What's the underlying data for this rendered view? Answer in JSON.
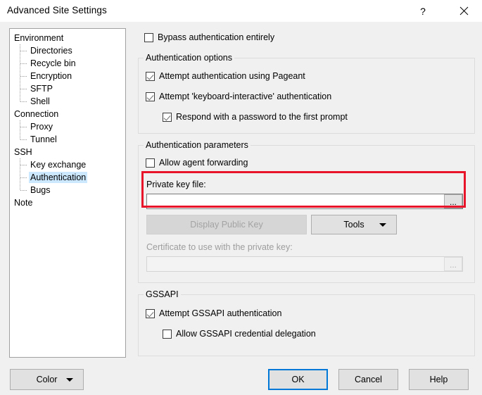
{
  "window": {
    "title": "Advanced Site Settings",
    "help_icon": "question-mark-icon",
    "close_icon": "close-icon"
  },
  "tree": {
    "items": [
      {
        "label": "Environment",
        "level": 0,
        "selected": false,
        "last": false
      },
      {
        "label": "Directories",
        "level": 1,
        "selected": false,
        "last": false
      },
      {
        "label": "Recycle bin",
        "level": 1,
        "selected": false,
        "last": false
      },
      {
        "label": "Encryption",
        "level": 1,
        "selected": false,
        "last": false
      },
      {
        "label": "SFTP",
        "level": 1,
        "selected": false,
        "last": false
      },
      {
        "label": "Shell",
        "level": 1,
        "selected": false,
        "last": true
      },
      {
        "label": "Connection",
        "level": 0,
        "selected": false,
        "last": false
      },
      {
        "label": "Proxy",
        "level": 1,
        "selected": false,
        "last": false
      },
      {
        "label": "Tunnel",
        "level": 1,
        "selected": false,
        "last": true
      },
      {
        "label": "SSH",
        "level": 0,
        "selected": false,
        "last": false
      },
      {
        "label": "Key exchange",
        "level": 1,
        "selected": false,
        "last": false
      },
      {
        "label": "Authentication",
        "level": 1,
        "selected": true,
        "last": false
      },
      {
        "label": "Bugs",
        "level": 1,
        "selected": false,
        "last": true
      },
      {
        "label": "Note",
        "level": 0,
        "selected": false,
        "last": false
      }
    ]
  },
  "main": {
    "bypass": {
      "label": "Bypass authentication entirely",
      "checked": false
    },
    "auth_options": {
      "caption": "Authentication options",
      "pageant": {
        "label": "Attempt authentication using Pageant",
        "checked": true
      },
      "keyboard_interactive": {
        "label": "Attempt 'keyboard-interactive' authentication",
        "checked": true
      },
      "respond_password": {
        "label": "Respond with a password to the first prompt",
        "checked": true
      }
    },
    "auth_parameters": {
      "caption": "Authentication parameters",
      "agent_forwarding": {
        "label": "Allow agent forwarding",
        "checked": false
      },
      "private_key": {
        "label": "Private key file:",
        "value": "",
        "placeholder": "",
        "browse_label": "..."
      },
      "display_public_key": {
        "label": "Display Public Key",
        "enabled": false
      },
      "tools": {
        "label": "Tools",
        "caret_icon": "chevron-down-icon",
        "enabled": true
      },
      "certificate": {
        "label": "Certificate to use with the private key:",
        "value": "",
        "placeholder": "",
        "browse_label": "...",
        "enabled": false
      }
    },
    "gssapi": {
      "caption": "GSSAPI",
      "attempt": {
        "label": "Attempt GSSAPI authentication",
        "checked": true
      },
      "delegation": {
        "label": "Allow GSSAPI credential delegation",
        "checked": false
      }
    }
  },
  "footer": {
    "color": {
      "label": "Color",
      "caret_icon": "chevron-down-icon"
    },
    "ok": {
      "label": "OK",
      "is_default": true
    },
    "cancel": {
      "label": "Cancel"
    },
    "help": {
      "label": "Help"
    }
  },
  "annotation": {
    "highlight_color": "#e8152a",
    "target": "private-key-file-row"
  }
}
